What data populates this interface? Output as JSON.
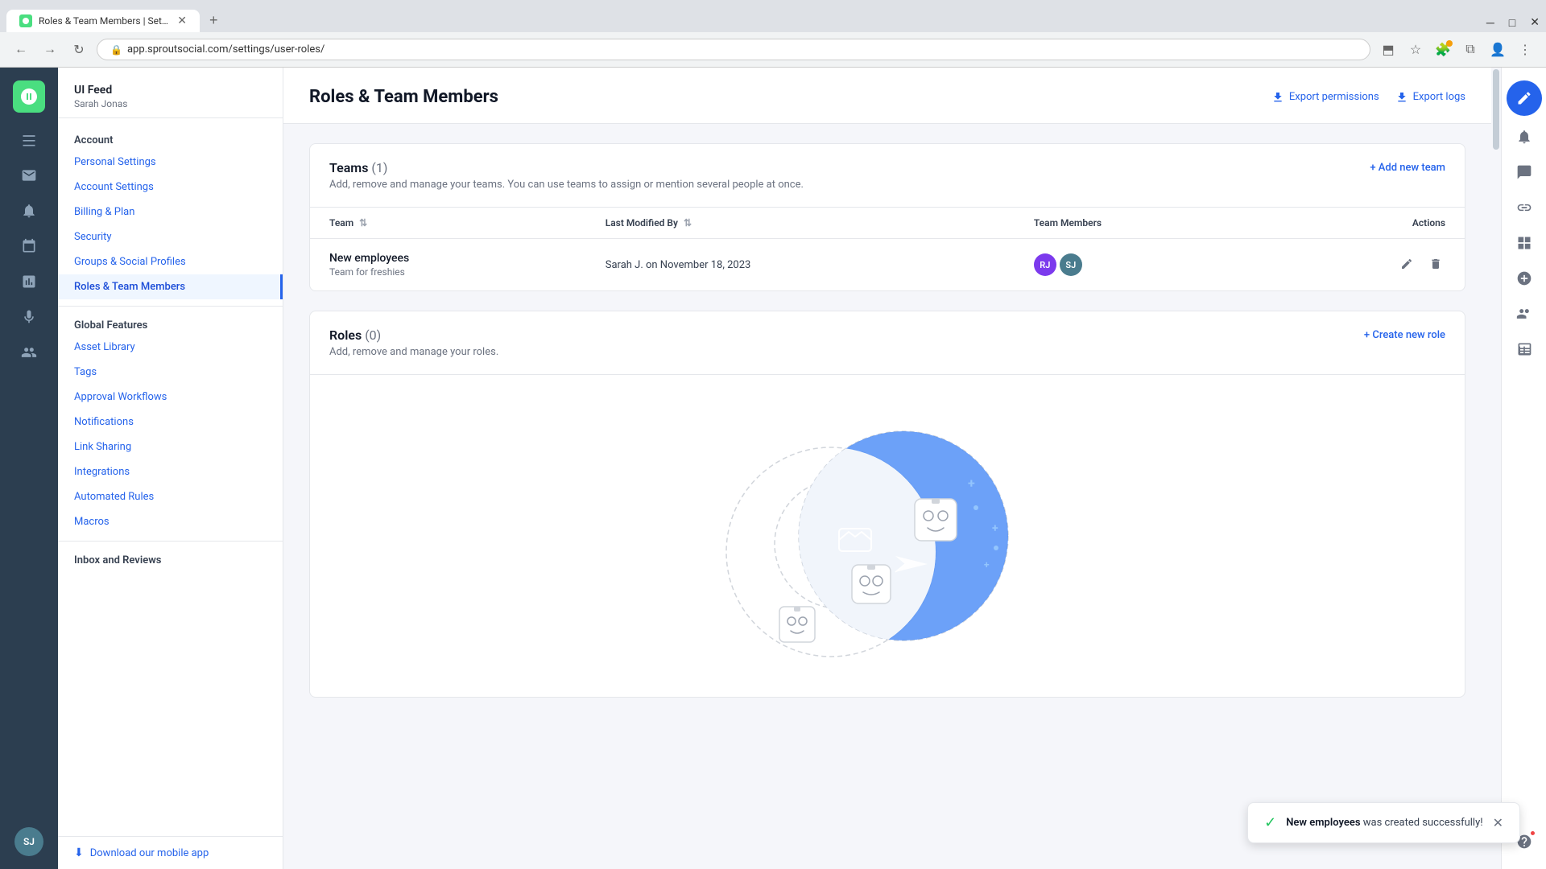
{
  "browser": {
    "tab_title": "Roles & Team Members | Settin...",
    "tab_favicon": "SS",
    "url": "app.sproutsocial.com/settings/user-roles/",
    "nav": {
      "back": "←",
      "forward": "→",
      "refresh": "↻"
    },
    "window_controls": {
      "minimize": "─",
      "maximize": "□",
      "close": "✕"
    }
  },
  "sidebar": {
    "org_name": "UI Feed",
    "user_name": "Sarah Jonas",
    "sections": [
      {
        "label": "Account",
        "items": [
          {
            "id": "personal-settings",
            "label": "Personal Settings",
            "active": false
          },
          {
            "id": "account-settings",
            "label": "Account Settings",
            "active": false
          },
          {
            "id": "billing-plan",
            "label": "Billing & Plan",
            "active": false
          },
          {
            "id": "security",
            "label": "Security",
            "active": false
          },
          {
            "id": "groups-social",
            "label": "Groups & Social Profiles",
            "active": false
          },
          {
            "id": "roles-team",
            "label": "Roles & Team Members",
            "active": true
          }
        ]
      },
      {
        "label": "Global Features",
        "items": [
          {
            "id": "asset-library",
            "label": "Asset Library",
            "active": false
          },
          {
            "id": "tags",
            "label": "Tags",
            "active": false
          },
          {
            "id": "approval-workflows",
            "label": "Approval Workflows",
            "active": false
          },
          {
            "id": "notifications",
            "label": "Notifications",
            "active": false
          },
          {
            "id": "link-sharing",
            "label": "Link Sharing",
            "active": false
          },
          {
            "id": "integrations",
            "label": "Integrations",
            "active": false
          },
          {
            "id": "automated-rules",
            "label": "Automated Rules",
            "active": false
          },
          {
            "id": "macros",
            "label": "Macros",
            "active": false
          }
        ]
      },
      {
        "label": "Inbox and Reviews",
        "items": []
      }
    ],
    "footer": {
      "download_label": "Download our mobile app"
    }
  },
  "header": {
    "title": "Roles & Team Members",
    "export_permissions": "Export permissions",
    "export_logs": "Export logs"
  },
  "teams_section": {
    "title": "Teams",
    "count": "(1)",
    "description": "Add, remove and manage your teams. You can use teams to assign or mention several people at once.",
    "add_btn": "+ Add new team",
    "columns": {
      "team": "Team",
      "last_modified": "Last Modified By",
      "members": "Team Members",
      "actions": "Actions"
    },
    "rows": [
      {
        "name": "New employees",
        "subtitle": "Team for freshies",
        "last_modified": "Sarah J. on November 18, 2023",
        "members": [
          "RJ",
          "SJ"
        ]
      }
    ]
  },
  "roles_section": {
    "title": "Roles",
    "count": "(0)",
    "description": "Add, remove and manage your roles.",
    "create_btn": "+ Create new role"
  },
  "toast": {
    "message_bold": "New employees",
    "message_rest": " was created successfully!",
    "close": "✕"
  },
  "rail_icons": {
    "logo": "🌱",
    "avatar_text": "SJ"
  },
  "right_rail_icons": [
    {
      "id": "compose",
      "label": "compose-icon",
      "active": true,
      "symbol": "✏"
    },
    {
      "id": "notifications",
      "label": "notifications-icon",
      "active": false,
      "symbol": "🔔"
    },
    {
      "id": "messages",
      "label": "messages-icon",
      "active": false,
      "symbol": "💬"
    },
    {
      "id": "link",
      "label": "link-icon",
      "active": false,
      "symbol": "🔗"
    },
    {
      "id": "grid",
      "label": "grid-icon",
      "active": false,
      "symbol": "⊞"
    },
    {
      "id": "add-circle",
      "label": "add-circle-icon",
      "active": false,
      "symbol": "⊕"
    },
    {
      "id": "user-check",
      "label": "user-check-icon",
      "active": false,
      "symbol": "👤"
    },
    {
      "id": "table",
      "label": "table-icon",
      "active": false,
      "symbol": "⊟"
    },
    {
      "id": "help",
      "label": "help-icon",
      "active": false,
      "symbol": "?"
    }
  ]
}
